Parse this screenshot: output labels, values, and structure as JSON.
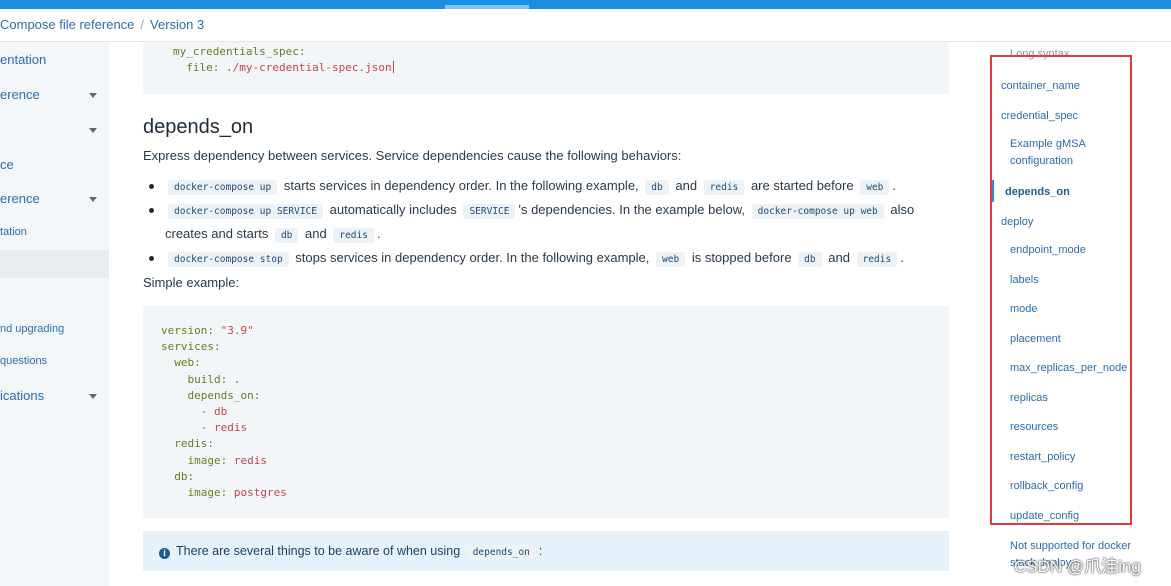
{
  "breadcrumb": {
    "items": [
      "Compose file reference",
      "Version 3"
    ],
    "separator": "/"
  },
  "sidebar": {
    "items": [
      {
        "label": "entation",
        "caret": false
      },
      {
        "label": "erence",
        "caret": true
      },
      {
        "label": "",
        "caret": true
      },
      {
        "label": "ce",
        "caret": false
      },
      {
        "label": "erence",
        "caret": true
      },
      {
        "label": "tation",
        "caret": false
      },
      {
        "label": "nd upgrading",
        "caret": false
      },
      {
        "label": " questions",
        "caret": false
      },
      {
        "label": "ications",
        "caret": true
      }
    ]
  },
  "main": {
    "top_code": [
      "my_credentials_spec:",
      "file: ",
      "./my-credential-spec.json"
    ],
    "section_title": "depends_on",
    "description": "Express dependency between services. Service dependencies cause the following behaviors:",
    "bullet1": {
      "c1": "docker-compose up",
      "t1": "starts services in dependency order. In the following example,",
      "c2": "db",
      "t2": "and",
      "c3": "redis",
      "t3": "are started before",
      "c4": "web",
      "t4": "."
    },
    "bullet2": {
      "c1": "docker-compose up SERVICE",
      "t1": "automatically includes",
      "c2": "SERVICE",
      "t2": "'s dependencies. In the example below,",
      "c3": "docker-compose up web",
      "t3": "also creates and starts",
      "c4": "db",
      "t4": "and",
      "c5": "redis",
      "t5": "."
    },
    "bullet3": {
      "c1": "docker-compose stop",
      "t1": "stops services in dependency order. In the following example,",
      "c2": "web",
      "t2": "is stopped before",
      "c3": "db",
      "t3": "and",
      "c4": "redis",
      "t4": "."
    },
    "simple_example": "Simple example:",
    "code": {
      "version_key": "version:",
      "version_val": "\"3.9\"",
      "services": "services:",
      "web": "web:",
      "build_key": "build:",
      "build_val": ".",
      "depends_key": "depends_on:",
      "dep1": "- db",
      "dep2": "- redis",
      "redis": "redis:",
      "image_key": "image:",
      "image_redis": "redis",
      "db": "db:",
      "image_key2": "image:",
      "image_pg": "postgres"
    },
    "note": {
      "text": "There are several things to be aware of when using",
      "code": "depends_on",
      "end": ":"
    }
  },
  "toc": {
    "items": [
      "Long syntax",
      "container_name",
      "credential_spec",
      "Example gMSA",
      "configuration",
      "depends_on",
      "deploy",
      "endpoint_mode",
      "labels",
      "mode",
      "placement",
      "max_replicas_per_node",
      "replicas",
      "resources",
      "restart_policy",
      "rollback_config",
      "update_config",
      "Not supported for docker",
      "stack deploy"
    ]
  },
  "watermark": "CSDN @爪洼ing",
  "colors": {
    "accent": "#1a8fe0",
    "link": "#2b6dad",
    "highlight_box": "#e13b3b"
  }
}
